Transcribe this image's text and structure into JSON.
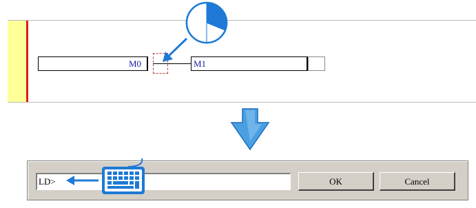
{
  "ladder": {
    "contact_operand": "M0",
    "coil_operand": "M1"
  },
  "dialog": {
    "input_value": "LD>",
    "ok_label": "OK",
    "cancel_label": "Cancel"
  },
  "icons": {
    "pointer": "clock-pie-callout-icon",
    "keyboard": "keyboard-icon",
    "down_arrow": "down-arrow-icon",
    "left_arrow": "left-arrow-icon"
  },
  "colors": {
    "power_rail": "#e31b1b",
    "gutter": "#ffff99",
    "operand_text": "#1a1aa8",
    "callout_blue": "#1e7ad6"
  }
}
